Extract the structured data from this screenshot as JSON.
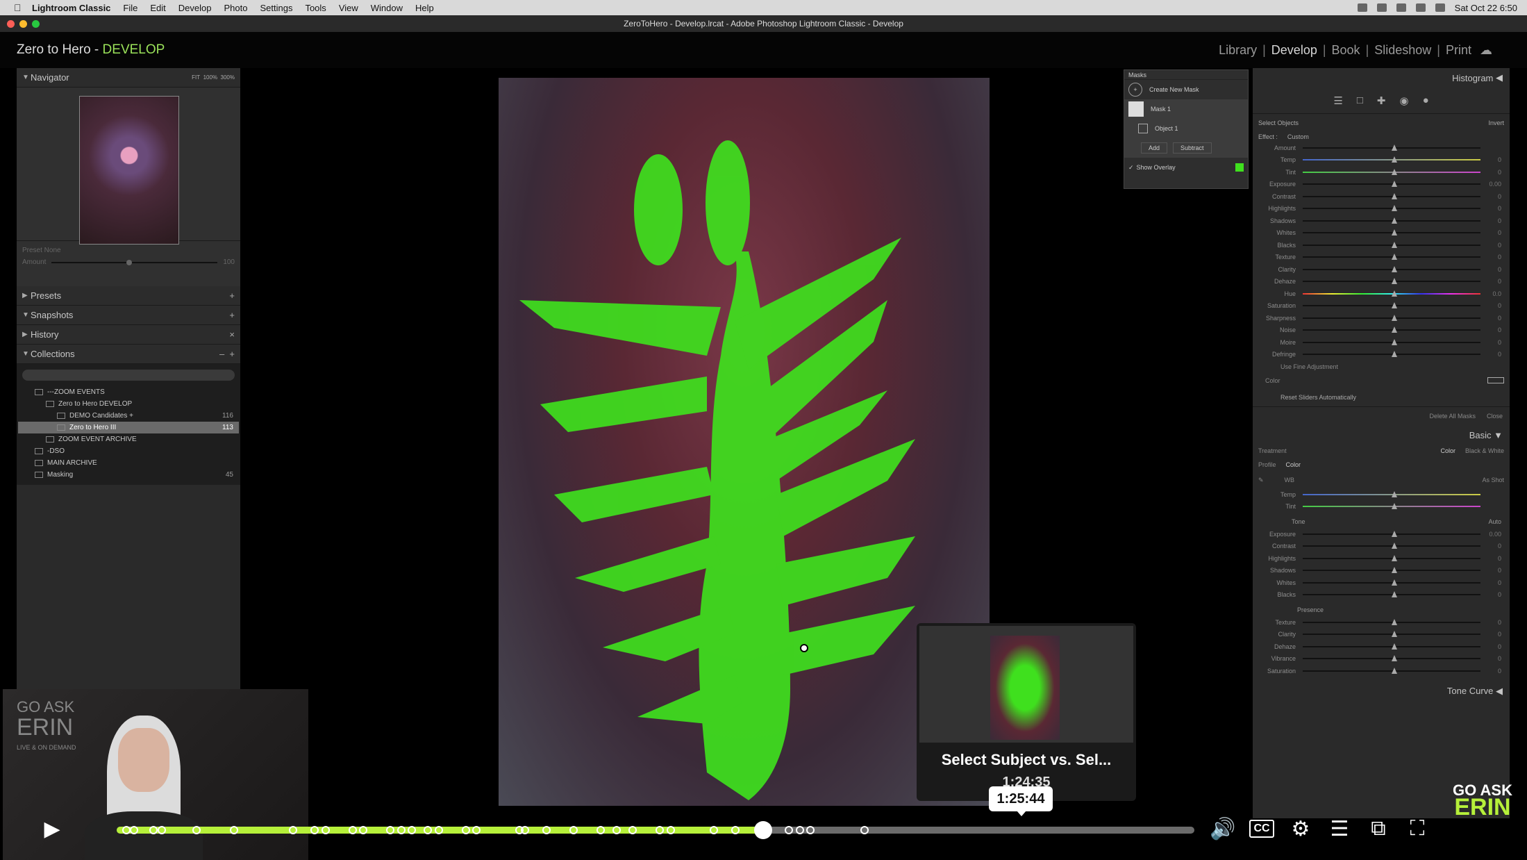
{
  "menubar": {
    "app": "Lightroom Classic",
    "items": [
      "File",
      "Edit",
      "Develop",
      "Photo",
      "Settings",
      "Tools",
      "View",
      "Window",
      "Help"
    ],
    "clock": "Sat Oct 22  6:50"
  },
  "window": {
    "title": "ZeroToHero - Develop.lrcat - Adobe Photoshop Lightroom Classic - Develop"
  },
  "header": {
    "identity_plate": "Zero to Hero - ",
    "identity_module": "DEVELOP",
    "modules": [
      "Library",
      "Develop",
      "Book",
      "Slideshow",
      "Print"
    ],
    "active_module": "Develop"
  },
  "left": {
    "navigator": {
      "label": "Navigator",
      "zoom": [
        "FIT",
        "100%",
        "300%"
      ]
    },
    "preset": {
      "label": "Preset  None",
      "amount_label": "Amount",
      "amount_value": "100"
    },
    "panels": [
      "Presets",
      "Snapshots",
      "History",
      "Collections"
    ],
    "collections": [
      {
        "name": "---ZOOM EVENTS",
        "count": ""
      },
      {
        "name": "Zero to Hero DEVELOP",
        "count": ""
      },
      {
        "name": "DEMO Candidates +",
        "count": "116"
      },
      {
        "name": "Zero to Hero III",
        "count": "113"
      },
      {
        "name": "ZOOM EVENT ARCHIVE",
        "count": ""
      },
      {
        "name": "-DSO",
        "count": ""
      },
      {
        "name": "MAIN ARCHIVE",
        "count": ""
      },
      {
        "name": "Masking",
        "count": "45"
      }
    ]
  },
  "masks": {
    "title": "Masks",
    "create": "Create New Mask",
    "mask1": "Mask 1",
    "object1": "Object 1",
    "add": "Add",
    "subtract": "Subtract",
    "show_overlay": "Show Overlay"
  },
  "right": {
    "histogram": "Histogram",
    "select_objects": "Select Objects",
    "invert": "Invert",
    "effect": "Effect :",
    "effect_value": "Custom",
    "mask_sliders": [
      {
        "label": "Amount",
        "value": ""
      },
      {
        "label": "Temp",
        "value": "0"
      },
      {
        "label": "Tint",
        "value": "0"
      },
      {
        "label": "Exposure",
        "value": "0.00"
      },
      {
        "label": "Contrast",
        "value": "0"
      },
      {
        "label": "Highlights",
        "value": "0"
      },
      {
        "label": "Shadows",
        "value": "0"
      },
      {
        "label": "Whites",
        "value": "0"
      },
      {
        "label": "Blacks",
        "value": "0"
      },
      {
        "label": "Texture",
        "value": "0"
      },
      {
        "label": "Clarity",
        "value": "0"
      },
      {
        "label": "Dehaze",
        "value": "0"
      },
      {
        "label": "Hue",
        "value": "0.0"
      },
      {
        "label": "Saturation",
        "value": "0"
      },
      {
        "label": "Sharpness",
        "value": "0"
      },
      {
        "label": "Noise",
        "value": "0"
      },
      {
        "label": "Moire",
        "value": "0"
      },
      {
        "label": "Defringe",
        "value": "0"
      }
    ],
    "use_fine": "Use Fine Adjustment",
    "color": "Color",
    "reset": "Reset Sliders Automatically",
    "delete_all": "Delete All Masks",
    "close": "Close",
    "basic": "Basic",
    "treatment": "Treatment",
    "treat_color": "Color",
    "treat_bw": "Black & White",
    "profile": "Profile",
    "profile_value": "Color",
    "wb": "WB",
    "wb_value": "As Shot",
    "tone": "Tone",
    "auto": "Auto",
    "presence": "Presence",
    "basic_sliders": [
      {
        "label": "Temp",
        "value": ""
      },
      {
        "label": "Tint",
        "value": ""
      },
      {
        "label": "Exposure",
        "value": "0.00"
      },
      {
        "label": "Contrast",
        "value": "0"
      },
      {
        "label": "Highlights",
        "value": "0"
      },
      {
        "label": "Shadows",
        "value": "0"
      },
      {
        "label": "Whites",
        "value": "0"
      },
      {
        "label": "Blacks",
        "value": "0"
      },
      {
        "label": "Texture",
        "value": "0"
      },
      {
        "label": "Clarity",
        "value": "0"
      },
      {
        "label": "Dehaze",
        "value": "0"
      },
      {
        "label": "Vibrance",
        "value": "0"
      },
      {
        "label": "Saturation",
        "value": "0"
      }
    ],
    "tone_curve": "Tone Curve"
  },
  "webcam": {
    "brand_top": "GO ASK",
    "brand_name": "ERIN",
    "brand_sub": "LIVE & ON DEMAND"
  },
  "player": {
    "preview_title": "Select Subject vs. Sel...",
    "preview_time": "1:24:35",
    "hover_time": "1:25:44",
    "progress": 0.6,
    "chapters": [
      0.005,
      0.012,
      0.03,
      0.038,
      0.07,
      0.105,
      0.16,
      0.18,
      0.19,
      0.215,
      0.225,
      0.25,
      0.26,
      0.27,
      0.285,
      0.295,
      0.32,
      0.33,
      0.37,
      0.375,
      0.395,
      0.42,
      0.445,
      0.46,
      0.475,
      0.5,
      0.51,
      0.55,
      0.57,
      0.6,
      0.62,
      0.63,
      0.64,
      0.69
    ],
    "logo_top": "GO ASK",
    "logo_name": "ERIN",
    "accent": "#b6f03a"
  }
}
